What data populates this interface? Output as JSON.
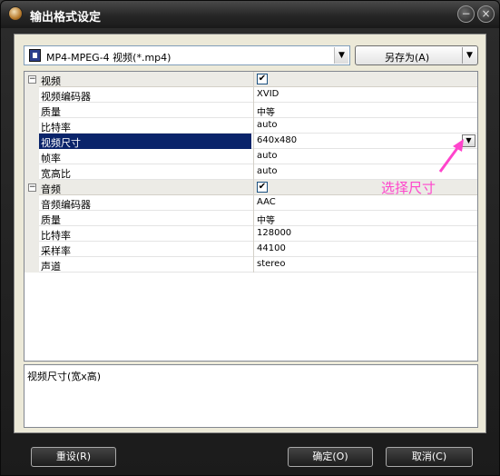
{
  "window": {
    "title": "输出格式设定"
  },
  "format": {
    "selected": "MP4-MPEG-4 视频(*.mp4)"
  },
  "toolbar": {
    "save_as_label": "另存为(A)"
  },
  "properties": {
    "video": {
      "label": "视频",
      "toggle": "⊟",
      "enabled": "✔",
      "items": [
        {
          "name": "视频编码器",
          "value": "XVID"
        },
        {
          "name": "质量",
          "value": "中等"
        },
        {
          "name": "比特率",
          "value": "auto"
        },
        {
          "name": "视频尺寸",
          "value": "640x480",
          "selected": true
        },
        {
          "name": "帧率",
          "value": "auto"
        },
        {
          "name": "宽高比",
          "value": "auto"
        }
      ]
    },
    "audio": {
      "label": "音频",
      "toggle": "⊟",
      "enabled": "✔",
      "items": [
        {
          "name": "音频编码器",
          "value": "AAC"
        },
        {
          "name": "质量",
          "value": "中等"
        },
        {
          "name": "比特率",
          "value": "128000"
        },
        {
          "name": "采样率",
          "value": "44100"
        },
        {
          "name": "声道",
          "value": "stereo"
        }
      ]
    }
  },
  "annotation": {
    "text": "选择尺寸",
    "color": "#ff44cc"
  },
  "description": {
    "text": "视频尺寸(宽x高)"
  },
  "buttons": {
    "reset": "重设(R)",
    "ok": "确定(O)",
    "cancel": "取消(C)"
  },
  "icons": {
    "dropdown": "▼",
    "minimize": "−",
    "close": "×"
  },
  "colors": {
    "selection": "#0a246a",
    "client": "#ece9d8"
  }
}
